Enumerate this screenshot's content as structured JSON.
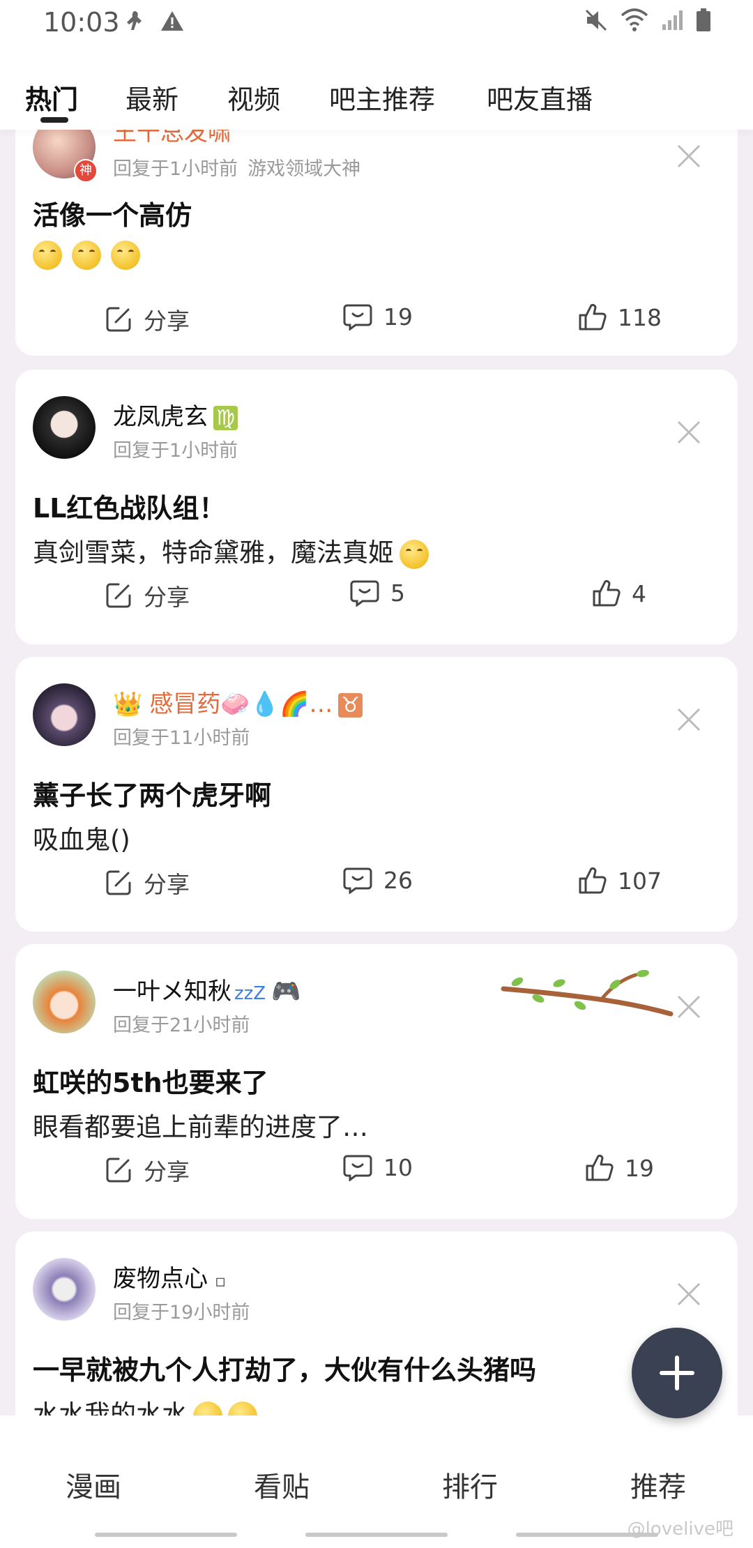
{
  "status_bar": {
    "time": "10:03"
  },
  "tabs": [
    {
      "label": "热门"
    },
    {
      "label": "最新"
    },
    {
      "label": "视频"
    },
    {
      "label": "吧主推荐"
    },
    {
      "label": "吧友直播"
    }
  ],
  "posts": [
    {
      "username": "王千总发啸",
      "reply_time": "回复于1小时前",
      "tag": "游戏领域大神",
      "avatar_badge": "神",
      "title": "活像一个高仿",
      "body": "",
      "share_label": "分享",
      "comments": "19",
      "likes": "118"
    },
    {
      "username": "龙凤虎玄",
      "zodiac": "♍",
      "reply_time": "回复于1小时前",
      "title": "LL红色战队组！",
      "body": "真剑雪菜，特命黛雅，魔法真姬",
      "share_label": "分享",
      "comments": "5",
      "likes": "4"
    },
    {
      "username": "感冒药🧼💧🌈…",
      "zodiac": "♉",
      "reply_time": "回复于11小时前",
      "title": "薰子长了两个虎牙啊",
      "body": "吸血鬼()",
      "share_label": "分享",
      "comments": "26",
      "likes": "107"
    },
    {
      "username": "一叶メ知秋",
      "zzz": "zzZ",
      "reply_time": "回复于21小时前",
      "title": "虹咲的5th也要来了",
      "body": "眼看都要追上前辈的进度了…",
      "share_label": "分享",
      "comments": "10",
      "likes": "19"
    },
    {
      "username": "废物点心",
      "reply_time": "回复于19小时前",
      "title": "一早就被九个人打劫了，大伙有什么头猪吗",
      "body": "水水我的水水"
    }
  ],
  "bottom_nav": [
    {
      "label": "漫画"
    },
    {
      "label": "看贴"
    },
    {
      "label": "排行"
    },
    {
      "label": "推荐"
    }
  ],
  "watermark": "@lovelive吧",
  "colors": {
    "accent": "#e36b3c",
    "fab": "#3a4152",
    "background": "#f3eef3"
  }
}
